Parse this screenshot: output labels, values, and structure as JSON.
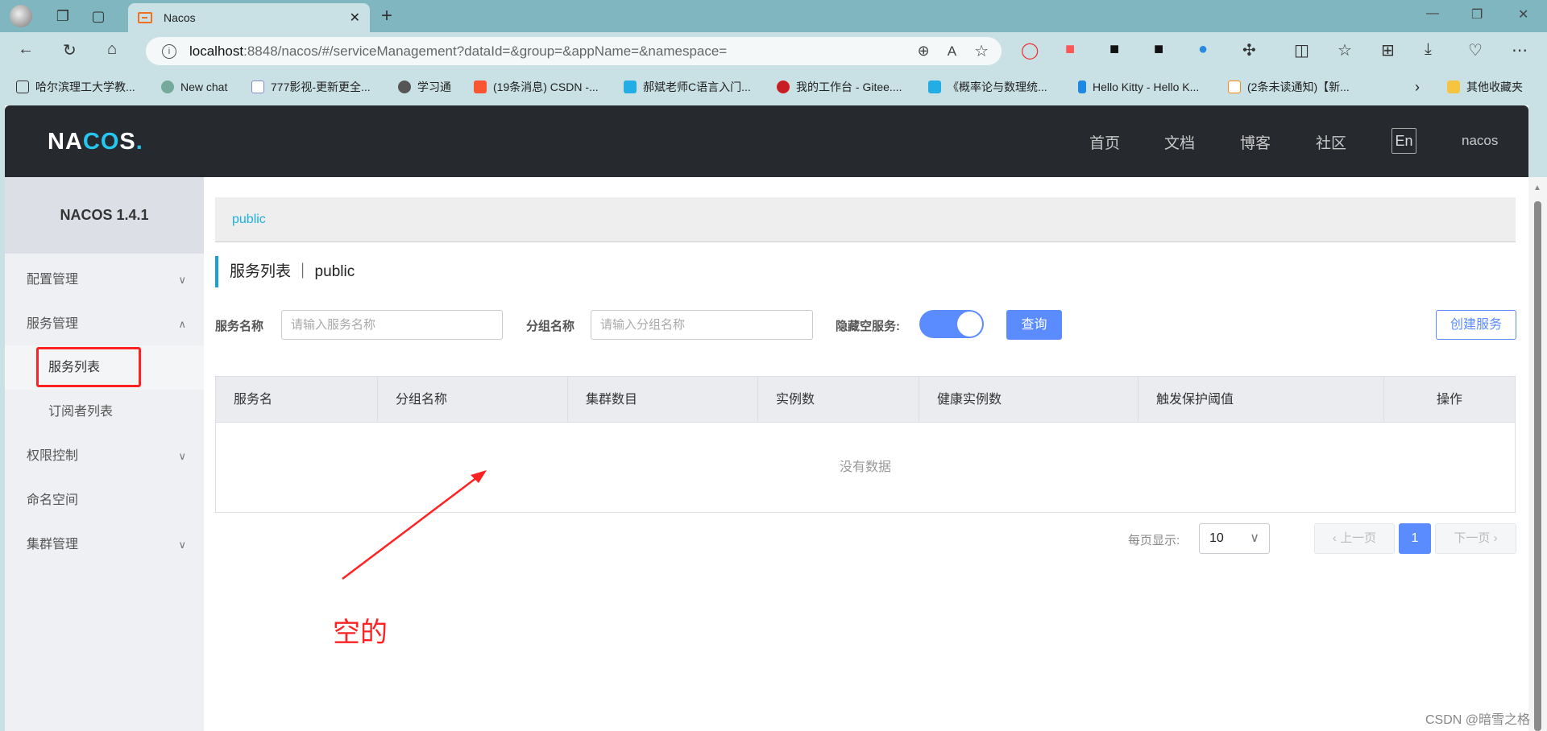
{
  "browser": {
    "tab_title": "Nacos",
    "url_host": "localhost",
    "url_rest": ":8848/nacos/#/serviceManagement?dataId=&group=&appName=&namespace=",
    "bookmarks": [
      {
        "label": "哈尔滨理工大学教...",
        "color": "#ffffff"
      },
      {
        "label": "New chat",
        "color": "#74aa9c"
      },
      {
        "label": "777影视-更新更全...",
        "color": "#ffffff"
      },
      {
        "label": "学习通",
        "color": "#555555"
      },
      {
        "label": "(19条消息) CSDN -...",
        "color": "#fc5531"
      },
      {
        "label": "郝斌老师C语言入门...",
        "color": "#23ade5"
      },
      {
        "label": "我的工作台 - Gitee....",
        "color": "#c71d23"
      },
      {
        "label": "《概率论与数理统...",
        "color": "#23ade5"
      },
      {
        "label": "Hello Kitty - Hello K...",
        "color": "#1e88e5"
      },
      {
        "label": "(2条未读通知)【新...",
        "color": "#ffffff"
      }
    ],
    "other_bookmarks": "其他收藏夹"
  },
  "header": {
    "logo": "NACOS.",
    "nav": [
      "首页",
      "文档",
      "博客",
      "社区"
    ],
    "lang": "En",
    "user": "nacos"
  },
  "sidebar": {
    "title": "NACOS 1.4.1",
    "items": [
      {
        "label": "配置管理",
        "chevron": "⌄"
      },
      {
        "label": "服务管理",
        "chevron": "^"
      },
      {
        "label": "服务列表",
        "active": true
      },
      {
        "label": "订阅者列表"
      },
      {
        "label": "权限控制",
        "chevron": "⌄"
      },
      {
        "label": "命名空间"
      },
      {
        "label": "集群管理",
        "chevron": "⌄"
      }
    ]
  },
  "main": {
    "namespace": "public",
    "title": "服务列表 ｜ public",
    "filters": {
      "service_label": "服务名称",
      "service_placeholder": "请输入服务名称",
      "group_label": "分组名称",
      "group_placeholder": "请输入分组名称",
      "hide_empty_label": "隐藏空服务:",
      "hide_empty_on": true,
      "query": "查询",
      "create": "创建服务"
    },
    "table": {
      "columns": [
        "服务名",
        "分组名称",
        "集群数目",
        "实例数",
        "健康实例数",
        "触发保护阈值",
        "操作"
      ],
      "rows": [],
      "empty": "没有数据"
    },
    "pagination": {
      "label": "每页显示:",
      "page_size": "10",
      "prev": "上一页",
      "current": "1",
      "next": "下一页"
    }
  },
  "annotation": {
    "text": "空的",
    "color": "#ff2222"
  },
  "watermark": "CSDN @暗雪之格",
  "colors": {
    "primary": "#5b8cff",
    "header_bg": "#262a2f",
    "accent": "#1aa0d8"
  }
}
